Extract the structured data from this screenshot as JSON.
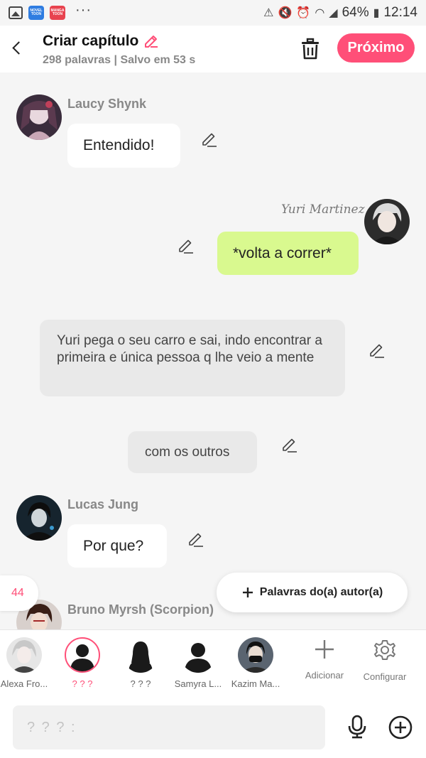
{
  "status_bar": {
    "apps": [
      "NOVEL TOON",
      "MANGA TOON"
    ],
    "dots": "···",
    "battery": "64%",
    "time": "12:14"
  },
  "header": {
    "title": "Criar capítulo",
    "subtitle": "298 palavras | Salvo em 53 s",
    "next_label": "Próximo"
  },
  "messages": [
    {
      "type": "left",
      "author": "Laucy Shynk",
      "text": "Entendido!"
    },
    {
      "type": "right",
      "author": "Yuri Martinez",
      "text": "*volta a correr*"
    },
    {
      "type": "narration",
      "text": "Yuri pega o seu carro e sai, indo encontrar a primeira e única pessoa q lhe veio a mente"
    },
    {
      "type": "narration",
      "text": "com os outros"
    },
    {
      "type": "left",
      "author": "Lucas Jung",
      "text": "Por que?"
    },
    {
      "type": "left",
      "author": "Bruno Myrsh (Scorpion)",
      "text": ""
    }
  ],
  "floating": {
    "count": "44",
    "author_words_label": "Palavras do(a) autor(a)"
  },
  "characters": [
    {
      "label": "Alexa Fro...",
      "active": false
    },
    {
      "label": "? ? ?",
      "active": true
    },
    {
      "label": "? ? ?",
      "active": false
    },
    {
      "label": "Samyra L...",
      "active": false
    },
    {
      "label": "Kazim Ma...",
      "active": false
    }
  ],
  "tools": {
    "add_label": "Adicionar",
    "settings_label": "Configurar"
  },
  "input": {
    "placeholder": "? ? ? :"
  },
  "colors": {
    "accent": "#ff4f78",
    "own_bubble": "#d9f98f",
    "narration": "#e9e9e9"
  }
}
